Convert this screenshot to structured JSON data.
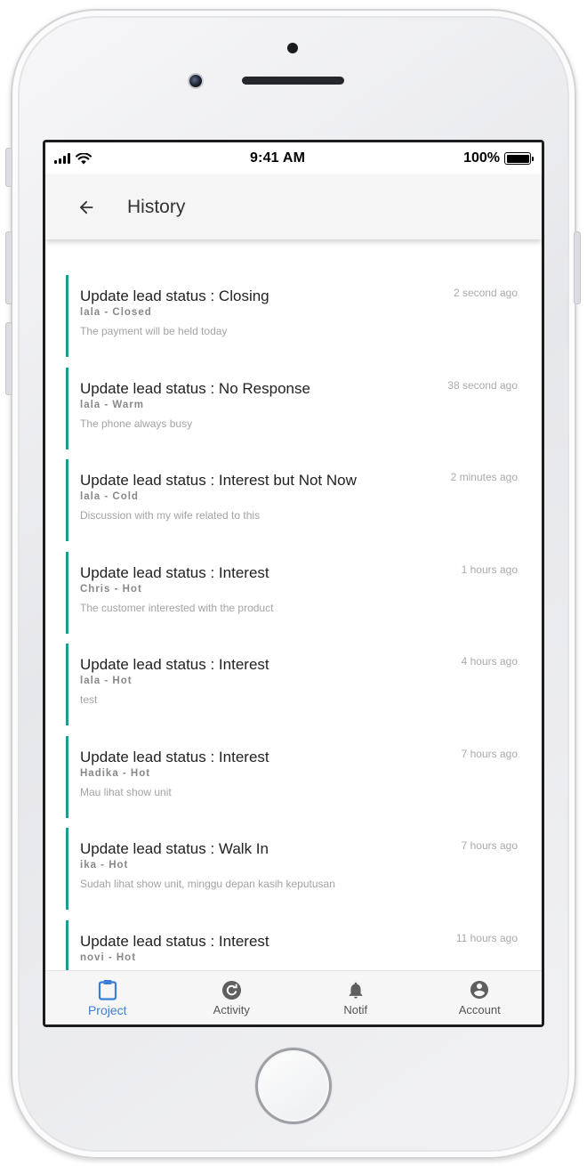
{
  "status_bar": {
    "time": "9:41 AM",
    "battery": "100%"
  },
  "app_bar": {
    "title": "History"
  },
  "accent_color": "#1f9c92",
  "active_color": "#3b7ed6",
  "history": [
    {
      "title": "Update lead status : Closing",
      "sub": "lala - Closed",
      "note": "The payment will be held today",
      "time": "2 second ago"
    },
    {
      "title": "Update lead status : No Response",
      "sub": "lala - Warm",
      "note": "The phone always busy",
      "time": "38 second ago"
    },
    {
      "title": "Update lead status : Interest but Not Now",
      "sub": "lala - Cold",
      "note": "Discussion with my wife related to this",
      "time": "2 minutes ago"
    },
    {
      "title": "Update lead status : Interest",
      "sub": "Chris - Hot",
      "note": "The customer interested with the product",
      "time": "1 hours ago"
    },
    {
      "title": "Update lead status : Interest",
      "sub": "lala - Hot",
      "note": "test",
      "time": "4 hours ago"
    },
    {
      "title": "Update lead status : Interest",
      "sub": "Hadika - Hot",
      "note": "Mau lihat show unit",
      "time": "7 hours ago"
    },
    {
      "title": "Update lead status : Walk In",
      "sub": "ika - Hot",
      "note": "Sudah lihat show unit, minggu depan kasih keputusan",
      "time": "7 hours ago"
    },
    {
      "title": "Update lead status : Interest",
      "sub": "novi - Hot",
      "note": "",
      "time": "11 hours ago"
    }
  ],
  "bottom_nav": [
    {
      "label": "Project",
      "icon": "clipboard-icon",
      "active": true
    },
    {
      "label": "Activity",
      "icon": "refresh-circle-icon",
      "active": false
    },
    {
      "label": "Notif",
      "icon": "bell-icon",
      "active": false
    },
    {
      "label": "Account",
      "icon": "account-circle-icon",
      "active": false
    }
  ]
}
